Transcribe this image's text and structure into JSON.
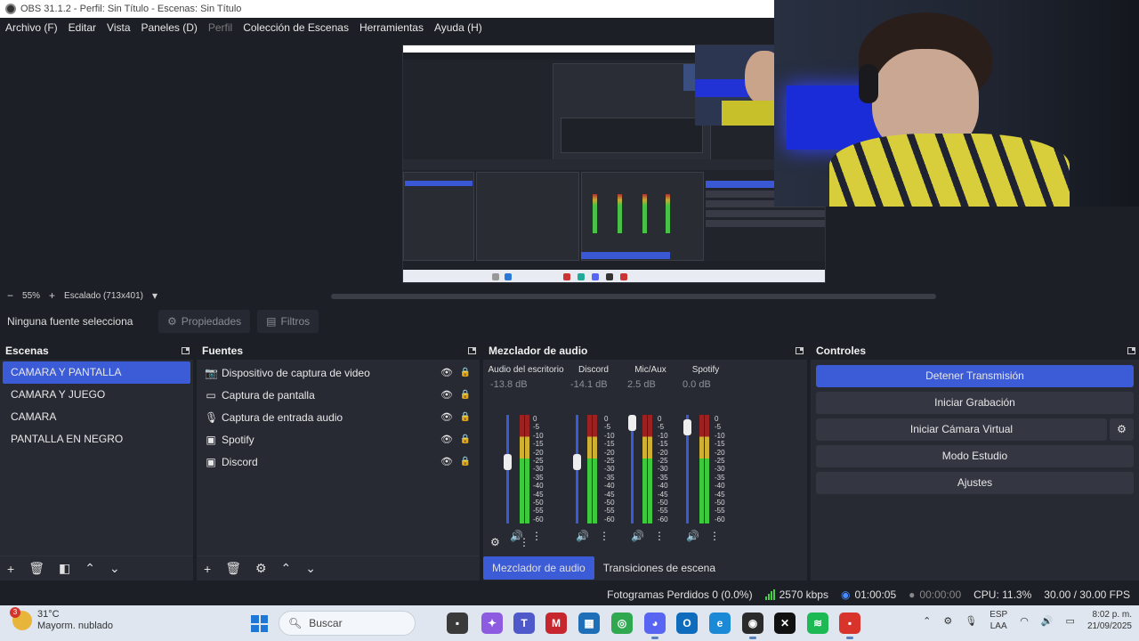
{
  "window": {
    "title": "OBS 31.1.2 - Perfil: Sin Título - Escenas: Sin Título"
  },
  "menu": [
    {
      "label": "Archivo (F)",
      "enabled": true
    },
    {
      "label": "Editar",
      "enabled": true
    },
    {
      "label": "Vista",
      "enabled": true
    },
    {
      "label": "Paneles (D)",
      "enabled": true
    },
    {
      "label": "Perfil",
      "enabled": false
    },
    {
      "label": "Colección de Escenas",
      "enabled": true
    },
    {
      "label": "Herramientas",
      "enabled": true
    },
    {
      "label": "Ayuda (H)",
      "enabled": true
    }
  ],
  "preview": {
    "zoom": "55%",
    "scale_label": "Escalado (713x401)"
  },
  "source_toolbar": {
    "no_selection": "Ninguna fuente selecciona",
    "properties": "Propiedades",
    "filters": "Filtros"
  },
  "scenes": {
    "title": "Escenas",
    "items": [
      "CAMARA Y PANTALLA",
      "CAMARA Y JUEGO",
      "CAMARA",
      "PANTALLA EN NEGRO"
    ],
    "active_index": 0
  },
  "sources": {
    "title": "Fuentes",
    "items": [
      {
        "label": "Dispositivo de captura de video",
        "icon": "camera-icon",
        "locked": false
      },
      {
        "label": "Captura de pantalla",
        "icon": "monitor-icon",
        "locked": true
      },
      {
        "label": "Captura de entrada audio",
        "icon": "microphone-icon",
        "locked": true
      },
      {
        "label": "Spotify",
        "icon": "window-capture-icon",
        "locked": true
      },
      {
        "label": "Discord",
        "icon": "window-capture-icon",
        "locked": true
      }
    ]
  },
  "mixer": {
    "title": "Mezclador de audio",
    "channels": [
      {
        "name": "Audio del escritorio",
        "db": "-13.8 dB",
        "level": 0.58
      },
      {
        "name": "Discord",
        "db": "-14.1 dB",
        "level": 0.58
      },
      {
        "name": "Mic/Aux",
        "db": "2.5 dB",
        "level": 1.0
      },
      {
        "name": "Spotify",
        "db": "0.0 dB",
        "level": 0.95
      }
    ],
    "scale": [
      "0",
      "-5",
      "-10",
      "-15",
      "-20",
      "-25",
      "-30",
      "-35",
      "-40",
      "-45",
      "-50",
      "-55",
      "-60"
    ],
    "tabs": [
      "Mezclador de audio",
      "Transiciones de escena"
    ]
  },
  "controls": {
    "title": "Controles",
    "stop_stream": "Detener Transmisión",
    "start_recording": "Iniciar Grabación",
    "start_virtual_cam": "Iniciar Cámara Virtual",
    "studio_mode": "Modo Estudio",
    "settings": "Ajustes"
  },
  "status": {
    "dropped_frames": "Fotogramas Perdidos 0 (0.0%)",
    "bitrate": "2570 kbps",
    "stream_time": "01:00:05",
    "rec_time": "00:00:00",
    "cpu": "CPU: 11.3%",
    "fps": "30.00 / 30.00 FPS"
  },
  "taskbar": {
    "weather_temp": "31°C",
    "weather_desc": "Mayorm. nublado",
    "weather_badge": "3",
    "search_placeholder": "Buscar",
    "lang_line1": "ESP",
    "lang_line2": "LAA",
    "time": "8:02 p. m.",
    "date": "21/09/2025"
  },
  "colors": {
    "accent": "#3c5bd6",
    "panel": "#272a33",
    "background": "#1d1f26"
  }
}
